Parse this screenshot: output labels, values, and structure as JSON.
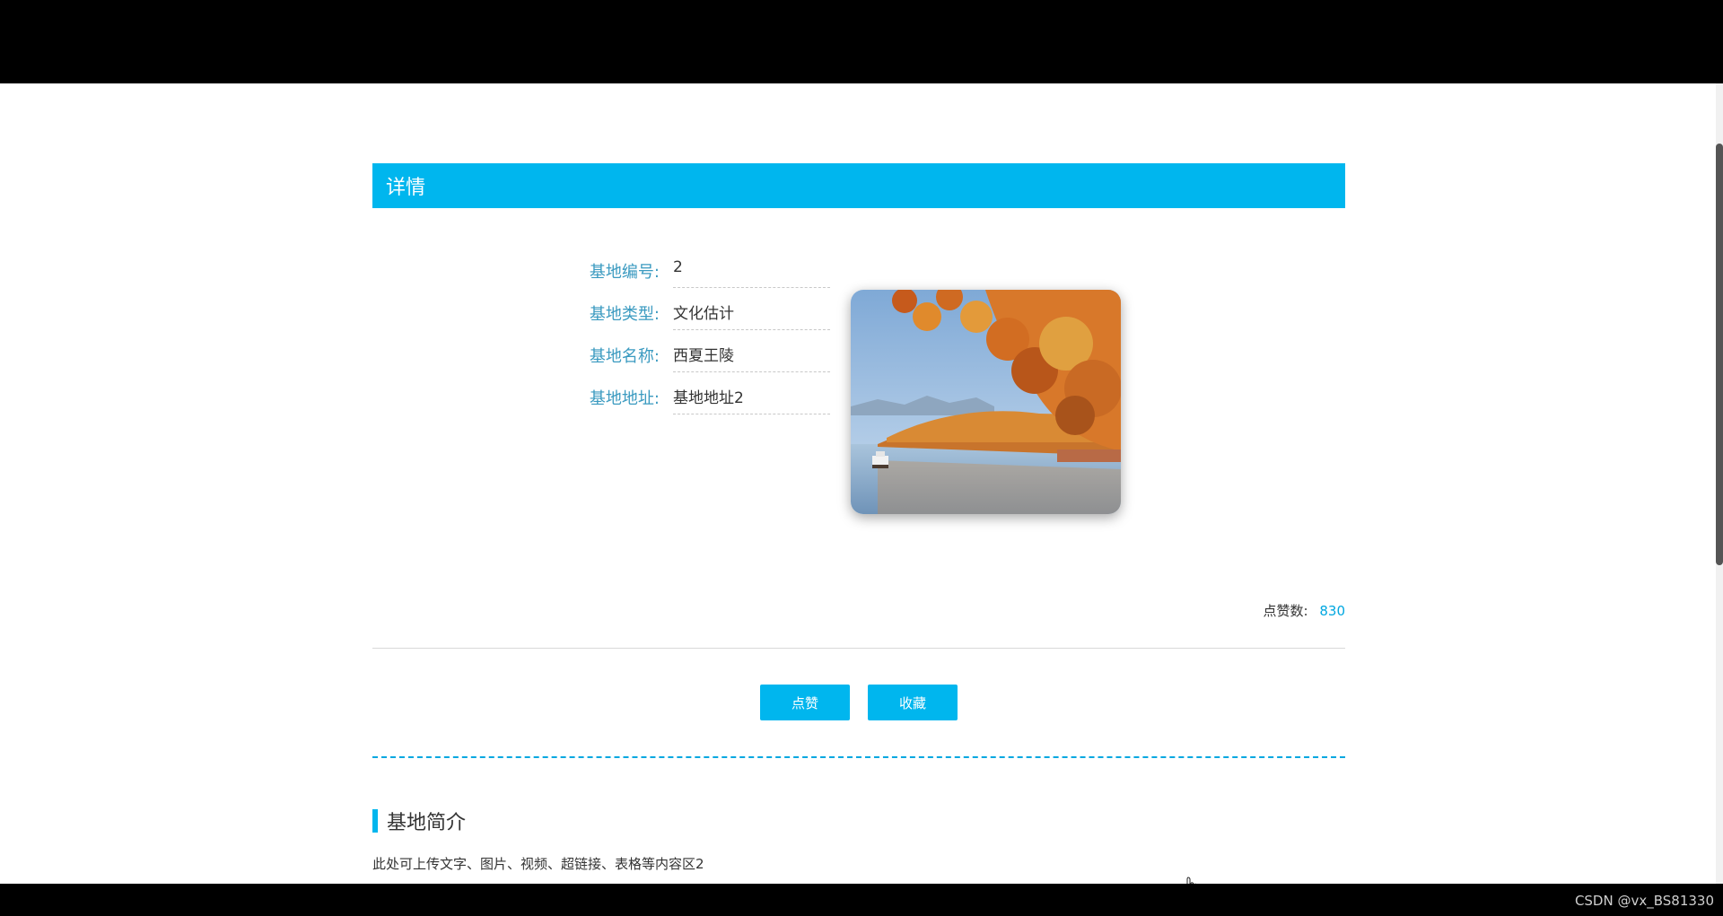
{
  "header": {
    "title": "详情"
  },
  "fields": [
    {
      "label": "基地编号:",
      "value": "2"
    },
    {
      "label": "基地类型:",
      "value": "文化估计"
    },
    {
      "label": "基地名称:",
      "value": "西夏王陵"
    },
    {
      "label": "基地地址:",
      "value": "基地地址2"
    }
  ],
  "likes": {
    "label": "点赞数:",
    "count": "830"
  },
  "actions": {
    "like_label": "点赞",
    "favorite_label": "收藏"
  },
  "intro": {
    "title": "基地简介",
    "content": "此处可上传文字、图片、视频、超链接、表格等内容区2"
  },
  "watermark": "CSDN @vx_BS81330",
  "colors": {
    "accent": "#00b6ee",
    "label": "#3a9ac0"
  }
}
